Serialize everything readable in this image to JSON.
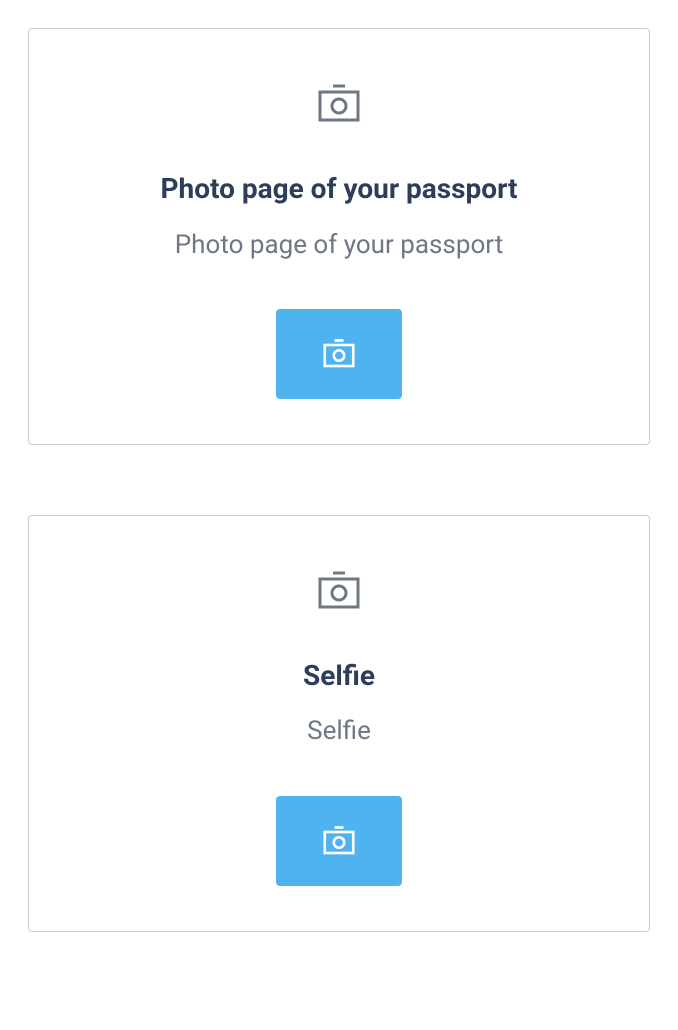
{
  "cards": [
    {
      "title": "Photo page of your passport",
      "subtitle": "Photo page of your passport"
    },
    {
      "title": "Selfie",
      "subtitle": "Selfie"
    }
  ],
  "colors": {
    "icon_gray": "#6e7783",
    "button_bg": "#4fb3ef",
    "button_icon": "#ffffff"
  }
}
